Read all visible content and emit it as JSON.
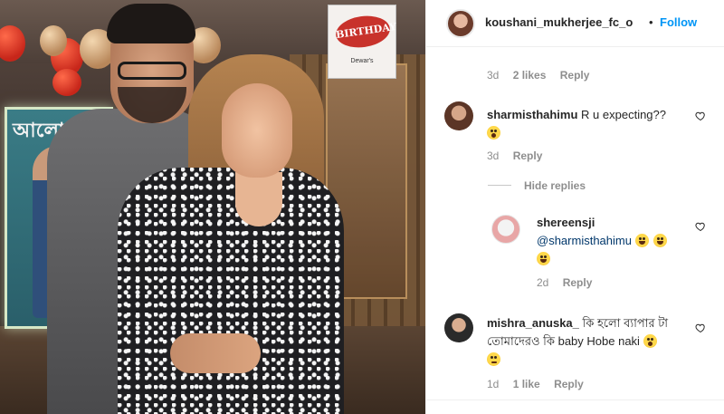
{
  "post": {
    "header": {
      "username": "koushani_mukherjee_fc_o",
      "separator": "•",
      "follow_label": "Follow"
    },
    "top_meta": {
      "time": "3d",
      "likes": "2 likes",
      "reply": "Reply"
    },
    "comments": [
      {
        "username": "sharmisthahimu",
        "text": "R u expecting??",
        "emoji": "shocked-face",
        "time": "3d",
        "reply": "Reply",
        "hide_replies_label": "Hide replies",
        "replies": [
          {
            "username": "shereensji",
            "mention": "@sharmisthahimu",
            "emojis": [
              "grinning-face",
              "grinning-face",
              "grinning-face"
            ],
            "time": "2d",
            "reply": "Reply"
          }
        ]
      },
      {
        "username": "mishra_anuska_",
        "text_line1": "কি হলো ব্যাপার টা",
        "text_line2": "তোমাদেরও কি baby Hobe naki",
        "emojis": [
          "shocked-face",
          "rolling-eyes-face"
        ],
        "time": "1d",
        "likes": "1 like",
        "reply": "Reply"
      }
    ]
  },
  "photo": {
    "sign_text": "BIRTHDAY",
    "sign_brand": "Dewar's",
    "poster_text": "আলো"
  },
  "colors": {
    "follow": "#0095f6",
    "meta": "#8e8e8e",
    "text": "#262626",
    "mention": "#00376b"
  }
}
